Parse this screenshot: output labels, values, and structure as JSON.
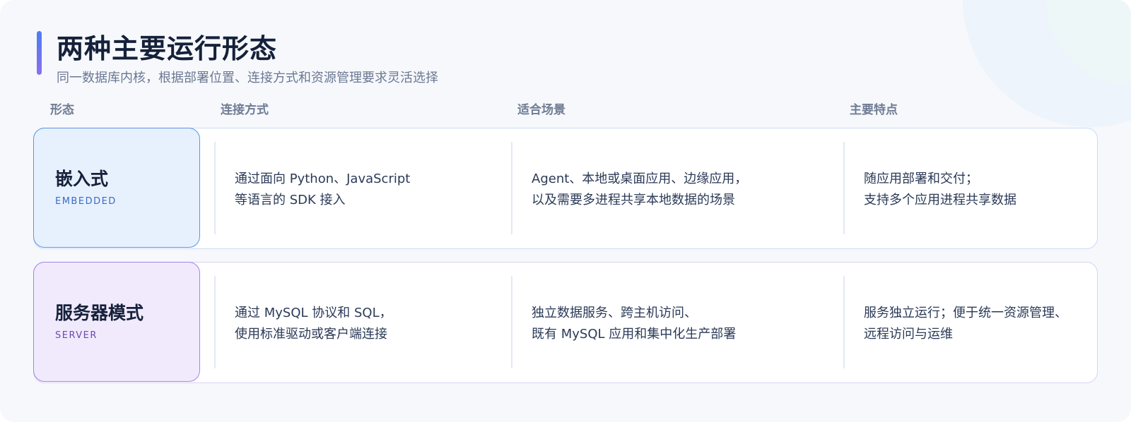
{
  "header": {
    "title": "两种主要运行形态",
    "subtitle": "同一数据库内核，根据部署位置、连接方式和资源管理要求灵活选择"
  },
  "columns": [
    "形态",
    "连接方式",
    "适合场景",
    "主要特点"
  ],
  "rows": [
    {
      "mode_name": "嵌入式",
      "mode_en": "EMBEDDED",
      "connection": [
        "通过面向 Python、JavaScript",
        "等语言的 SDK 接入"
      ],
      "scenarios": [
        "Agent、本地或桌面应用、边缘应用，",
        "以及需要多进程共享本地数据的场景"
      ],
      "features": [
        "随应用部署和交付；",
        "支持多个应用进程共享数据"
      ]
    },
    {
      "mode_name": "服务器模式",
      "mode_en": "SERVER",
      "connection": [
        "通过 MySQL 协议和 SQL，",
        "使用标准驱动或客户端连接"
      ],
      "scenarios": [
        "独立数据服务、跨主机访问、",
        "既有 MySQL 应用和集中化生产部署"
      ],
      "features": [
        "服务独立运行；便于统一资源管理、",
        "远程访问与运维"
      ]
    }
  ],
  "colors": {
    "accent_blue": "#5b95e4",
    "accent_purple": "#a882e6",
    "title": "#15213a"
  }
}
